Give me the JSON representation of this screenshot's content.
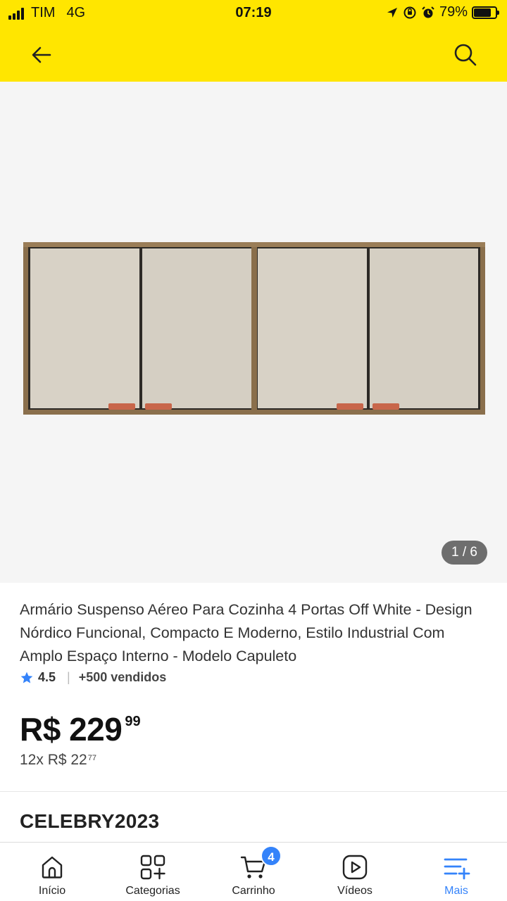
{
  "status_bar": {
    "carrier": "TIM",
    "network": "4G",
    "time": "07:19",
    "battery": "79%",
    "battery_level": 0.79
  },
  "app_bar": {
    "back_icon": "arrow-left-icon",
    "search_icon": "search-icon"
  },
  "gallery": {
    "counter": "1 / 6",
    "current_index": 1,
    "total": 6
  },
  "product": {
    "title": "Armário Suspenso Aéreo Para Cozinha 4 Portas Off White - Design Nórdico Funcional, Compacto E Moderno, Estilo Industrial Com Amplo Espaço Interno - Modelo Capuleto",
    "rating": "4.5",
    "separator": "|",
    "sold": "+500 vendidos",
    "price_main": "R$ 229",
    "price_cents": "99",
    "installments": "12x R$ 22",
    "installments_cents": "77",
    "coupon": "CELEBRY2023"
  },
  "tabbar": {
    "tabs": [
      {
        "label": "Início",
        "icon": "home-icon"
      },
      {
        "label": "Categorias",
        "icon": "categories-icon"
      },
      {
        "label": "Carrinho",
        "icon": "cart-icon",
        "badge": "4"
      },
      {
        "label": "Vídeos",
        "icon": "video-play-icon"
      },
      {
        "label": "Mais",
        "icon": "menu-plus-icon",
        "active": true
      }
    ]
  },
  "colors": {
    "brand_yellow": "#ffe600",
    "accent_blue": "#3483fa",
    "gallery_bg": "#f5f5f5"
  }
}
